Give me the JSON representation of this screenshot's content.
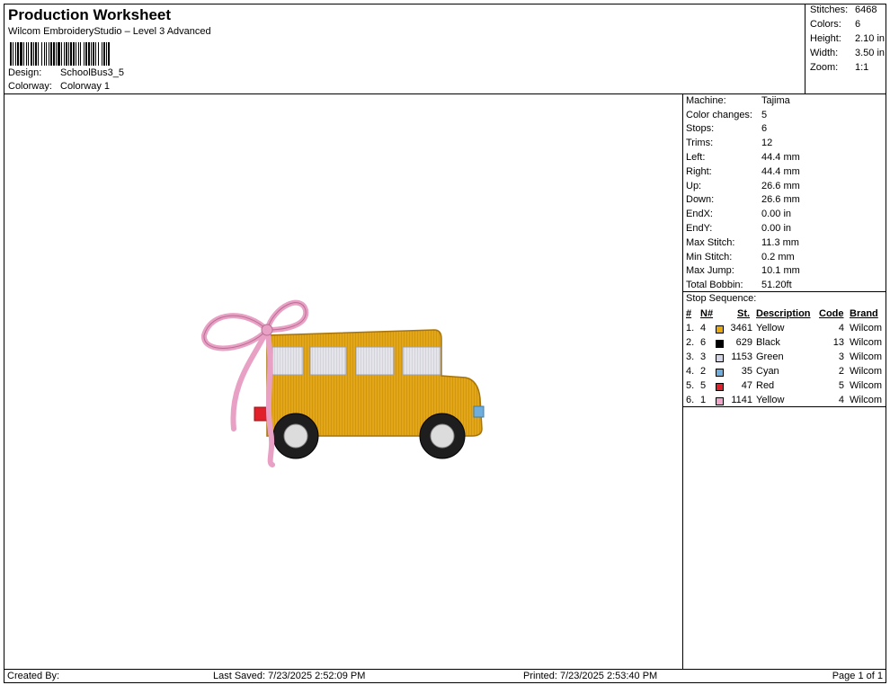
{
  "header": {
    "title": "Production Worksheet",
    "subtitle": "Wilcom EmbroideryStudio – Level 3 Advanced",
    "design_label": "Design:",
    "design_value": "SchoolBus3_5",
    "colorway_label": "Colorway:",
    "colorway_value": "Colorway 1"
  },
  "summary": [
    {
      "label": "Stitches:",
      "value": "6468"
    },
    {
      "label": "Colors:",
      "value": "6"
    },
    {
      "label": "Height:",
      "value": "2.10 in"
    },
    {
      "label": "Width:",
      "value": "3.50 in"
    },
    {
      "label": "Zoom:",
      "value": "1:1"
    }
  ],
  "info": [
    {
      "label": "Machine:",
      "value": "Tajima"
    },
    {
      "label": "Color changes:",
      "value": "5"
    },
    {
      "label": "Stops:",
      "value": "6"
    },
    {
      "label": "Trims:",
      "value": "12"
    },
    {
      "label": "Left:",
      "value": "44.4 mm"
    },
    {
      "label": "Right:",
      "value": "44.4 mm"
    },
    {
      "label": "Up:",
      "value": "26.6 mm"
    },
    {
      "label": "Down:",
      "value": "26.6 mm"
    },
    {
      "label": "EndX:",
      "value": "0.00 in"
    },
    {
      "label": "EndY:",
      "value": "0.00 in"
    },
    {
      "label": "Max Stitch:",
      "value": "11.3 mm"
    },
    {
      "label": "Min Stitch:",
      "value": "0.2 mm"
    },
    {
      "label": "Max Jump:",
      "value": "10.1 mm"
    },
    {
      "label": "Total Bobbin:",
      "value": "51.20ft"
    }
  ],
  "stop_sequence": {
    "title": "Stop Sequence:",
    "headers": {
      "num": "#",
      "n": "N#",
      "st": "St.",
      "desc": "Description",
      "code": "Code",
      "brand": "Brand"
    },
    "rows": [
      {
        "num": "1.",
        "n": "4",
        "color": "#E8A90E",
        "st": "3461",
        "desc": "Yellow",
        "code": "4",
        "brand": "Wilcom"
      },
      {
        "num": "2.",
        "n": "6",
        "color": "#000000",
        "st": "629",
        "desc": "Black",
        "code": "13",
        "brand": "Wilcom"
      },
      {
        "num": "3.",
        "n": "3",
        "color": "#D4D4E8",
        "st": "1153",
        "desc": "Green",
        "code": "3",
        "brand": "Wilcom"
      },
      {
        "num": "4.",
        "n": "2",
        "color": "#6FAEDC",
        "st": "35",
        "desc": "Cyan",
        "code": "2",
        "brand": "Wilcom"
      },
      {
        "num": "5.",
        "n": "5",
        "color": "#E0202A",
        "st": "47",
        "desc": "Red",
        "code": "5",
        "brand": "Wilcom"
      },
      {
        "num": "6.",
        "n": "1",
        "color": "#F0A6C8",
        "st": "1141",
        "desc": "Yellow",
        "code": "4",
        "brand": "Wilcom"
      }
    ]
  },
  "footer": {
    "created_by": "Created By:",
    "last_saved": "Last Saved: 7/23/2025 2:52:09 PM",
    "printed": "Printed: 7/23/2025 2:53:40 PM",
    "page": "Page 1 of 1"
  }
}
